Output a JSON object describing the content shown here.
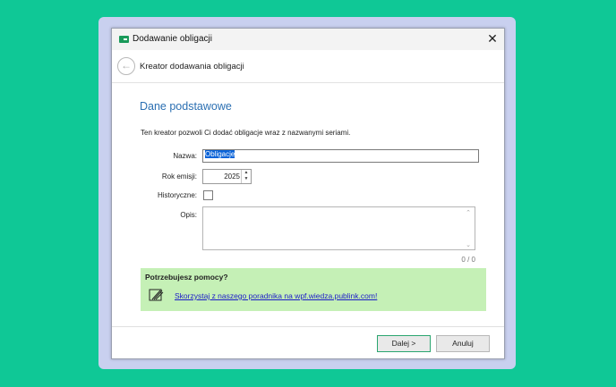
{
  "window": {
    "title": "Dodawanie obligacji",
    "close_symbol": "✕",
    "app_icon": "folder-money-icon"
  },
  "header": {
    "title": "Kreator dodawania obligacji",
    "back_symbol": "←"
  },
  "form": {
    "section_title": "Dane podstawowe",
    "intro": "Ten kreator pozwoli Ci dodać obligacje wraz z nazwanymi seriami.",
    "name_label": "Nazwa:",
    "name_value": "Obligacje",
    "year_label": "Rok emisji:",
    "year_value": "2025",
    "historic_label": "Historyczne:",
    "historic_checked": false,
    "desc_label": "Opis:",
    "desc_value": "",
    "desc_counter": "0 / 0"
  },
  "help": {
    "title": "Potrzebujesz pomocy?",
    "link": "Skorzystaj z naszego poradnika na wpf.wiedza.publink.com!",
    "icon": "book-pencil-icon"
  },
  "buttons": {
    "next": "Dalej >",
    "cancel": "Anuluj"
  },
  "colors": {
    "background": "#0fc896",
    "frame": "#c9d0ef",
    "accent": "#2b6fb2",
    "help_bg": "#c5f0b6",
    "link": "#1a1ac8"
  }
}
